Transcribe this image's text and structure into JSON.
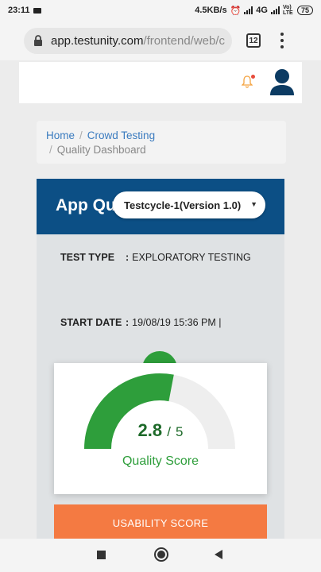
{
  "status_bar": {
    "time": "23:11",
    "network_speed": "4.5KB/s",
    "network_type": "4G",
    "volte": "Vo) LTE",
    "battery": "75"
  },
  "browser": {
    "url_host": "app.testunity.com",
    "url_path": "/frontend/web/c",
    "tab_count": "12"
  },
  "breadcrumb": {
    "items": [
      "Home",
      "Crowd Testing",
      "Quality Dashboard"
    ],
    "separator": "/"
  },
  "card": {
    "title": "App Qu",
    "cycle_select": {
      "value": "Testcycle-1(Version 1.0)"
    },
    "test_type_label": "TEST TYPE",
    "test_type_value": "EXPLORATORY TESTING",
    "start_date_label": "START DATE",
    "start_date_value": "19/08/19 15:36 PM |",
    "colon": ":"
  },
  "quality": {
    "score": "2.8",
    "separator": "/",
    "max": "5",
    "label": "Quality Score",
    "gauge_fraction": 0.56,
    "colors": {
      "fill": "#2e9e3b",
      "track": "#eeeeee"
    }
  },
  "usability_button": {
    "label": "USABILITY SCORE"
  },
  "colors": {
    "header_blue": "#0c4f85",
    "link_blue": "#3a7bbf",
    "orange": "#f47a42",
    "green": "#2e9e3b"
  }
}
